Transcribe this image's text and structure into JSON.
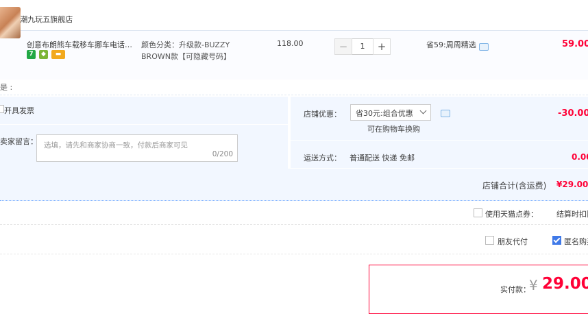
{
  "store": {
    "label": "店铺: 潮九玩五旗舰店"
  },
  "item": {
    "title": "创意布朗熊车载移车挪车电话牌...",
    "badges": {
      "seven_days": "7"
    },
    "sku": "颜色分类：升级款-BUZZY BROWN款【可隐藏号码】",
    "price": "118.00",
    "quantity": "1",
    "qty_minus": "−",
    "qty_plus": "+",
    "promo": "省59:周周精选",
    "subtotal": "59.00"
  },
  "partial_label": "是 :",
  "invoice": {
    "label": "开具发票"
  },
  "message": {
    "label": "卖家留言：",
    "placeholder": "选填，请先和商家协商一致，付款后商家可见",
    "count": "0/200"
  },
  "discount": {
    "label": "店铺优惠：",
    "selected": "省30元:组合优惠",
    "swap_note": "可在购物车换购",
    "amount": "-30.00"
  },
  "shipping": {
    "label": "运送方式：",
    "value": "普通配送 快递 免邮",
    "amount": "0.00"
  },
  "store_total": {
    "label": "店铺合计(含运费)",
    "value": "¥29.00"
  },
  "tmall_points": {
    "label": "使用天猫点券：",
    "note": "结算时扣除"
  },
  "friend_pay": {
    "label": "朋友代付"
  },
  "anonymous": {
    "label": "匿名购买"
  },
  "payment": {
    "label": "实付款：",
    "currency": "¥",
    "amount": "29.00"
  },
  "colors": {
    "price_red": "#ff0036",
    "row_blue": "#f2f7ff",
    "check_blue": "#3f79e8"
  }
}
